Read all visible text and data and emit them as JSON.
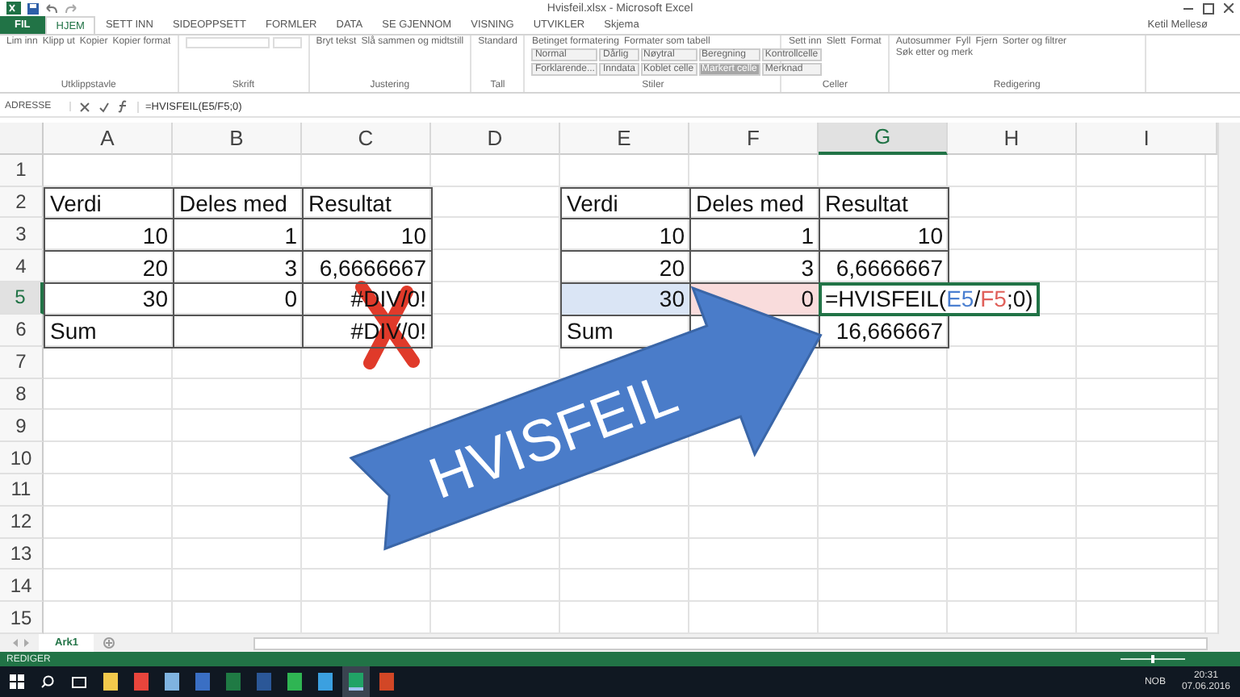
{
  "window": {
    "title": "Hvisfeil.xlsx - Microsoft Excel",
    "user": "Ketil Mellesø"
  },
  "tabs": [
    {
      "label": "FIL",
      "selected": false,
      "kind": "file"
    },
    {
      "label": "HJEM",
      "selected": true,
      "kind": "tab"
    },
    {
      "label": "SETT INN",
      "selected": false,
      "kind": "tab"
    },
    {
      "label": "SIDEOPPSETT",
      "selected": false,
      "kind": "tab"
    },
    {
      "label": "FORMLER",
      "selected": false,
      "kind": "tab"
    },
    {
      "label": "DATA",
      "selected": false,
      "kind": "tab"
    },
    {
      "label": "SE GJENNOM",
      "selected": false,
      "kind": "tab"
    },
    {
      "label": "VISNING",
      "selected": false,
      "kind": "tab"
    },
    {
      "label": "UTVIKLER",
      "selected": false,
      "kind": "tab"
    },
    {
      "label": "Skjema",
      "selected": false,
      "kind": "tab"
    }
  ],
  "ribbon_groups": [
    {
      "label": "Utklippstavle",
      "items": [
        "Lim inn",
        "Klipp ut",
        "Kopier",
        "Kopier format"
      ]
    },
    {
      "label": "Skrift"
    },
    {
      "label": "Justering",
      "items": [
        "Bryt tekst",
        "Slå sammen og midtstill"
      ]
    },
    {
      "label": "Tall",
      "items": [
        "Standard"
      ]
    },
    {
      "label": "Stiler",
      "items": [
        "Betinget formatering",
        "Formater som tabell"
      ],
      "styles": [
        {
          "label": "Normal",
          "selected": false
        },
        {
          "label": "Dårlig",
          "selected": false
        },
        {
          "label": "Nøytral",
          "selected": false
        },
        {
          "label": "Beregning",
          "selected": false
        },
        {
          "label": "Kontrollcelle",
          "selected": false
        },
        {
          "label": "Forklarende...",
          "selected": false
        },
        {
          "label": "Inndata",
          "selected": false
        },
        {
          "label": "Koblet celle",
          "selected": false
        },
        {
          "label": "Markert celle",
          "selected": true
        },
        {
          "label": "Merknad",
          "selected": false
        }
      ]
    },
    {
      "label": "Celler",
      "items": [
        "Sett inn",
        "Slett",
        "Format"
      ]
    },
    {
      "label": "Redigering",
      "items": [
        "Autosummer",
        "Fyll",
        "Fjern",
        "Sorter og filtrer",
        "Søk etter og merk"
      ]
    }
  ],
  "name_box": "ADRESSE",
  "formula": "=HVISFEIL(E5/F5;0)",
  "columns": [
    {
      "label": "A",
      "selected": false
    },
    {
      "label": "B",
      "selected": false
    },
    {
      "label": "C",
      "selected": false
    },
    {
      "label": "D",
      "selected": false
    },
    {
      "label": "E",
      "selected": false
    },
    {
      "label": "F",
      "selected": false
    },
    {
      "label": "G",
      "selected": true
    },
    {
      "label": "H",
      "selected": false
    },
    {
      "label": "I",
      "selected": false
    }
  ],
  "rows": [
    {
      "label": "1",
      "selected": false,
      "cells": [
        {},
        {},
        {},
        {},
        {},
        {},
        {},
        {},
        {}
      ]
    },
    {
      "label": "2",
      "selected": false,
      "cells": [
        {
          "text": "Verdi",
          "kind": "text",
          "bordered": true
        },
        {
          "text": "Deles med",
          "kind": "text",
          "bordered": true
        },
        {
          "text": "Resultat",
          "kind": "text",
          "bordered": true
        },
        {},
        {
          "text": "Verdi",
          "kind": "text",
          "bordered": true
        },
        {
          "text": "Deles med",
          "kind": "text",
          "bordered": true
        },
        {
          "text": "Resultat",
          "kind": "text",
          "bordered": true
        },
        {},
        {}
      ]
    },
    {
      "label": "3",
      "selected": false,
      "cells": [
        {
          "text": "10",
          "kind": "number",
          "bordered": true
        },
        {
          "text": "1",
          "kind": "number",
          "bordered": true
        },
        {
          "text": "10",
          "kind": "number",
          "bordered": true
        },
        {},
        {
          "text": "10",
          "kind": "number",
          "bordered": true
        },
        {
          "text": "1",
          "kind": "number",
          "bordered": true
        },
        {
          "text": "10",
          "kind": "number",
          "bordered": true
        },
        {},
        {}
      ]
    },
    {
      "label": "4",
      "selected": false,
      "cells": [
        {
          "text": "20",
          "kind": "number",
          "bordered": true
        },
        {
          "text": "3",
          "kind": "number",
          "bordered": true
        },
        {
          "text": "6,6666667",
          "kind": "number",
          "bordered": true
        },
        {},
        {
          "text": "20",
          "kind": "number",
          "bordered": true
        },
        {
          "text": "3",
          "kind": "number",
          "bordered": true
        },
        {
          "text": "6,6666667",
          "kind": "number",
          "bordered": true
        },
        {},
        {}
      ]
    },
    {
      "label": "5",
      "selected": true,
      "cells": [
        {
          "text": "30",
          "kind": "number",
          "bordered": true
        },
        {
          "text": "0",
          "kind": "number",
          "bordered": true
        },
        {
          "text": "#DIV/0!",
          "kind": "number",
          "bordered": true
        },
        {},
        {
          "text": "30",
          "kind": "number",
          "bordered": true,
          "color": "#dae5f5"
        },
        {
          "text": "0",
          "kind": "number",
          "bordered": true,
          "color": "#f9dcdc"
        },
        {
          "kind": "formula",
          "bordered": true,
          "parts": [
            {
              "text": "=HVISFEIL("
            },
            {
              "text": "E5",
              "color": "#4a7fd0"
            },
            {
              "text": "/"
            },
            {
              "text": "F5",
              "color": "#e0605a"
            },
            {
              "text": ";0)"
            }
          ]
        },
        {},
        {}
      ]
    },
    {
      "label": "6",
      "selected": false,
      "cells": [
        {
          "text": "Sum",
          "kind": "text",
          "bordered": true
        },
        {
          "bordered": true
        },
        {
          "text": "#DIV/0!",
          "kind": "number",
          "bordered": true
        },
        {},
        {
          "text": "Sum",
          "kind": "text",
          "bordered": true
        },
        {
          "bordered": true
        },
        {
          "text": "16,666667",
          "kind": "number",
          "bordered": true
        },
        {},
        {}
      ]
    },
    {
      "label": "7",
      "selected": false,
      "cells": [
        {},
        {},
        {},
        {},
        {},
        {},
        {},
        {},
        {}
      ]
    },
    {
      "label": "8",
      "selected": false,
      "cells": [
        {},
        {},
        {},
        {},
        {},
        {},
        {},
        {},
        {}
      ]
    },
    {
      "label": "9",
      "selected": false,
      "cells": [
        {},
        {},
        {},
        {},
        {},
        {},
        {},
        {},
        {}
      ]
    },
    {
      "label": "10",
      "selected": false,
      "cells": [
        {},
        {},
        {},
        {},
        {},
        {},
        {},
        {},
        {}
      ]
    },
    {
      "label": "11",
      "selected": false,
      "cells": [
        {},
        {},
        {},
        {},
        {},
        {},
        {},
        {},
        {}
      ]
    },
    {
      "label": "12",
      "selected": false,
      "cells": [
        {},
        {},
        {},
        {},
        {},
        {},
        {},
        {},
        {}
      ]
    },
    {
      "label": "13",
      "selected": false,
      "cells": [
        {},
        {},
        {},
        {},
        {},
        {},
        {},
        {},
        {}
      ]
    },
    {
      "label": "14",
      "selected": false,
      "cells": [
        {},
        {},
        {},
        {},
        {},
        {},
        {},
        {},
        {}
      ]
    },
    {
      "label": "15",
      "selected": false,
      "cells": [
        {},
        {},
        {},
        {},
        {},
        {},
        {},
        {},
        {}
      ]
    }
  ],
  "overlay": {
    "arrow_text": "HVISFEIL"
  },
  "sheet_tabs": [
    {
      "label": "Ark1",
      "selected": true
    }
  ],
  "status_bar": {
    "mode": "REDIGER",
    "zoom": {
      "level": 0.5
    }
  },
  "taskbar": {
    "apps": [
      {
        "color": "#f2c94c",
        "active": false
      },
      {
        "color": "#e8453c",
        "active": false
      },
      {
        "color": "#7fb3e0",
        "active": false
      },
      {
        "color": "#3a6fc4",
        "active": false
      },
      {
        "color": "#1f7a44",
        "active": false
      },
      {
        "color": "#2b5797",
        "active": false
      },
      {
        "color": "#2fb553",
        "active": false
      },
      {
        "color": "#3ba0e0",
        "active": false
      },
      {
        "color": "#21a366",
        "active": true
      },
      {
        "color": "#d24726",
        "active": false
      }
    ],
    "language": "NOB",
    "time": "20:31",
    "date": "07.06.2016"
  }
}
